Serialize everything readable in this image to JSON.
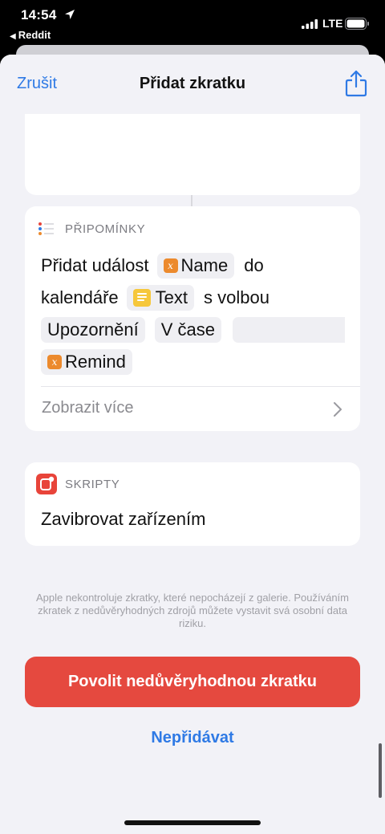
{
  "status_bar": {
    "time": "14:54",
    "back_app": "Reddit",
    "network": "LTE"
  },
  "navbar": {
    "cancel_label": "Zrušit",
    "title": "Přidat zkratku",
    "share_icon": "share-icon"
  },
  "reminders_card": {
    "category": "PŘIPOMÍNKY",
    "words": {
      "add_event": "Přidat událost",
      "name_var": "Name",
      "to": "do",
      "calendar": "kalendáře",
      "text_var": "Text",
      "with_option": "s volbou",
      "notification": "Upozornění",
      "at_time": "V čase",
      "remind_var": "Remind"
    },
    "var_symbol": "x",
    "show_more": "Zobrazit více"
  },
  "scripts_card": {
    "category": "SKRIPTY",
    "action": "Zavibrovat zařízením"
  },
  "disclaimer": "Apple nekontroluje zkratky, které nepocházejí z galerie. Používáním zkratek z nedůvěryhodných zdrojů můžete vystavit svá osobní data riziku.",
  "buttons": {
    "allow": "Povolit nedůvěryhodnou zkratku",
    "dont_add": "Nepřidávat"
  },
  "colors": {
    "accent": "#2f7ae5",
    "danger": "#e5493f",
    "variable": "#ec8a2d",
    "text_var": "#f6c73b"
  }
}
